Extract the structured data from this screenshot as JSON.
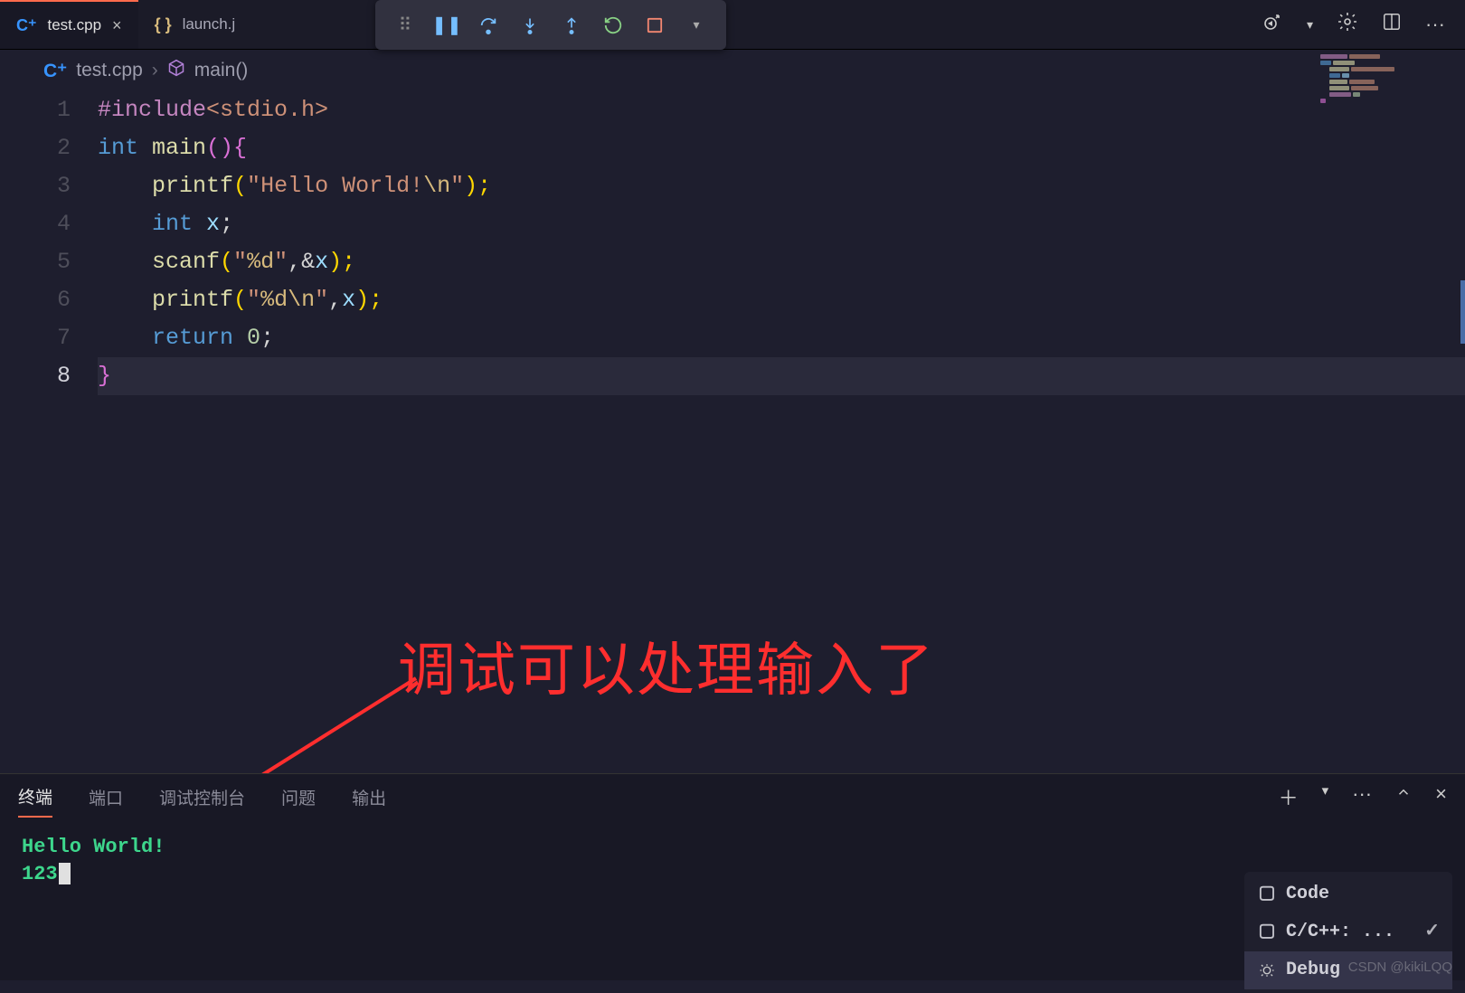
{
  "tabs": {
    "active": {
      "label": "test.cpp"
    },
    "inactive": {
      "label": "launch.j"
    }
  },
  "breadcrumb": {
    "file": "test.cpp",
    "symbol": "main()"
  },
  "gutter": [
    "1",
    "2",
    "3",
    "4",
    "5",
    "6",
    "7",
    "8"
  ],
  "code": {
    "l1": {
      "pp": "#include",
      "hdr": "<stdio.h>"
    },
    "l2": {
      "kw": "int",
      "fn": "main",
      "par": "(){"
    },
    "l3": {
      "fn": "printf",
      "open": "(",
      "q1": "\"",
      "s": "Hello World!",
      "esc": "\\n",
      "q2": "\"",
      "close": ");"
    },
    "l4": {
      "kw": "int",
      "var": "x",
      "semi": ";"
    },
    "l5": {
      "fn": "scanf",
      "open": "(",
      "q1": "\"",
      "esc": "%d",
      "q2": "\"",
      "comma": ",&",
      "var": "x",
      "close": ");"
    },
    "l6": {
      "fn": "printf",
      "open": "(",
      "q1": "\"",
      "esc": "%d\\n",
      "q2": "\"",
      "comma": ",",
      "var": "x",
      "close": ");"
    },
    "l7": {
      "kw": "return",
      "num": "0",
      "semi": ";"
    },
    "l8": {
      "brace": "}"
    }
  },
  "annotation": "调试可以处理输入了",
  "panel": {
    "tabs": [
      "终端",
      "端口",
      "调试控制台",
      "问题",
      "输出"
    ],
    "active_tab": 0
  },
  "terminal": {
    "line1": "Hello World!",
    "line2": "123"
  },
  "term_list": {
    "items": [
      {
        "label": "Code",
        "icon": "box"
      },
      {
        "label": "C/C++: ...",
        "icon": "box",
        "check": true
      },
      {
        "label": "Debug",
        "icon": "bug",
        "active": true
      }
    ]
  },
  "watermark": "CSDN @kikiLQQ"
}
